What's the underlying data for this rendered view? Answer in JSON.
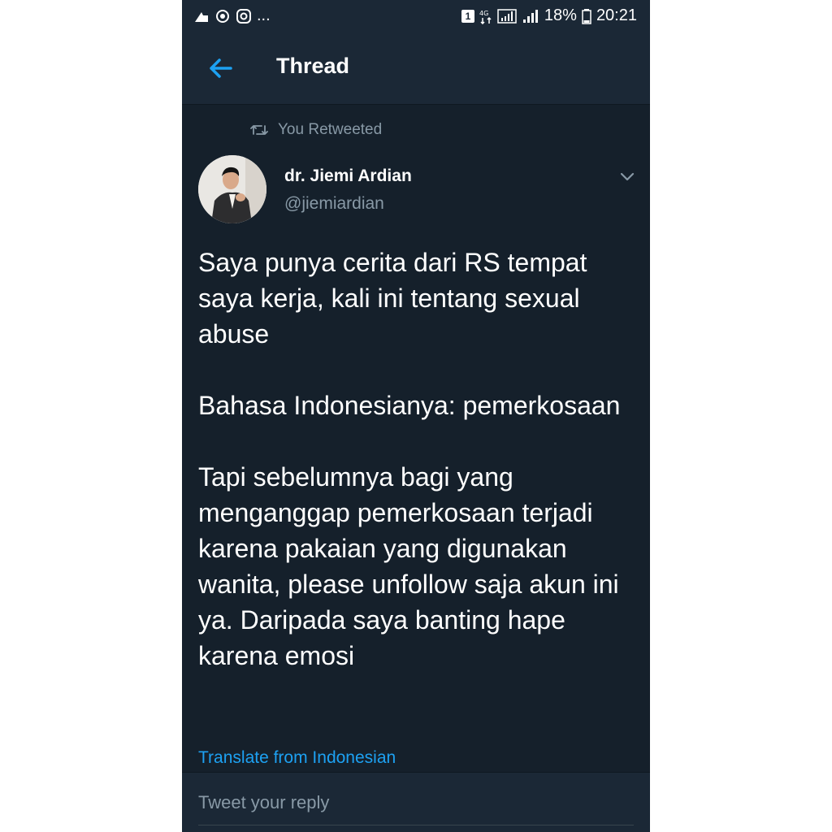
{
  "status_bar": {
    "left_icons": [
      "notification-icon",
      "sync-icon",
      "instagram-icon"
    ],
    "more": "...",
    "sim_badge": "1",
    "network": "4G",
    "battery_percent": "18%",
    "time": "20:21"
  },
  "header": {
    "back_icon": "arrow-left-icon",
    "title": "Thread"
  },
  "tweet": {
    "retweet_label": "You Retweeted",
    "author_name": "dr. Jiemi Ardian",
    "author_handle": "@jiemiardian",
    "text": "Saya punya cerita dari RS tempat saya kerja, kali ini tentang sexual abuse\n\nBahasa Indonesianya: pemerkosaan\n\nTapi sebelumnya bagi yang menganggap pemerkosaan terjadi karena pakaian yang digunakan wanita, please unfollow saja akun ini ya. Daripada saya banting hape karena emosi",
    "translate_label": "Translate from Indonesian"
  },
  "reply": {
    "placeholder": "Tweet your reply"
  },
  "colors": {
    "background": "#15202b",
    "bar": "#1b2836",
    "accent": "#1da1f2",
    "secondary_text": "#8899a6"
  }
}
